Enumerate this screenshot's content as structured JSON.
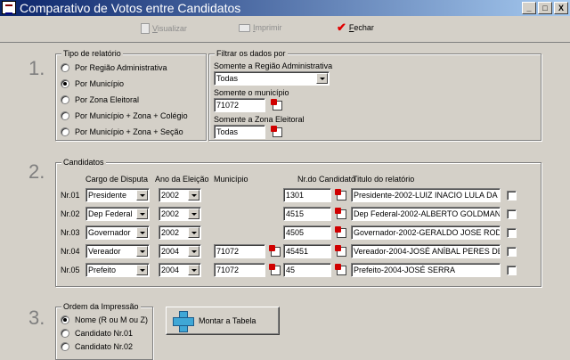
{
  "window": {
    "title": "Comparativo de Votos entre Candidatos",
    "buttons": [
      "_",
      "□",
      "X"
    ]
  },
  "toolbar": {
    "visualizar": {
      "first": "V",
      "rest": "isualizar"
    },
    "imprimir": {
      "first": "I",
      "rest": "mprimir"
    },
    "fechar": {
      "first": "F",
      "rest": "echar"
    }
  },
  "section1": {
    "number": "1.",
    "tipo_legend": "Tipo de relatório",
    "options": [
      "Por Região Administrativa",
      "Por Município",
      "Por Zona Eleitoral",
      "Por Município + Zona + Colégio",
      "Por Município + Zona + Seção"
    ],
    "selected_index": 1,
    "filtrar_legend": "Filtrar os dados por",
    "regiao_label": "Somente a Região Administrativa",
    "regiao_value": "Todas",
    "municipio_label": "Somente o município",
    "municipio_value": "71072",
    "zona_label": "Somente a Zona Eleitoral",
    "zona_value": "Todas"
  },
  "section2": {
    "number": "2.",
    "legend": "Candidatos",
    "headers": {
      "cargo": "Cargo de Disputa",
      "ano": "Ano da Eleição",
      "municipio": "Município",
      "nr": "Nr.do Candidato",
      "titulo": "Titulo do relatório"
    },
    "rows": [
      {
        "label": "Nr.01",
        "cargo": "Presidente",
        "ano": "2002",
        "municipio": "",
        "nr": "1301",
        "titulo": "Presidente-2002-LUIZ INACIO LULA DA"
      },
      {
        "label": "Nr.02",
        "cargo": "Dep Federal",
        "ano": "2002",
        "municipio": "",
        "nr": "4515",
        "titulo": "Dep Federal-2002-ALBERTO GOLDMAN"
      },
      {
        "label": "Nr.03",
        "cargo": "Governador",
        "ano": "2002",
        "municipio": "",
        "nr": "4505",
        "titulo": "Governador-2002-GERALDO JOSE ROD"
      },
      {
        "label": "Nr.04",
        "cargo": "Vereador",
        "ano": "2004",
        "municipio": "71072",
        "nr": "45451",
        "titulo": "Vereador-2004-JOSÉ ANÍBAL PERES DE"
      },
      {
        "label": "Nr.05",
        "cargo": "Prefeito",
        "ano": "2004",
        "municipio": "71072",
        "nr": "45",
        "titulo": "Prefeito-2004-JOSÉ SERRA"
      }
    ]
  },
  "section3": {
    "number": "3.",
    "legend": "Ordem da Impressão",
    "options": [
      "Nome (R ou M ou Z)",
      "Candidato Nr.01",
      "Candidato Nr.02"
    ],
    "selected_index": 0,
    "montar_label": "Montar a Tabela"
  },
  "icons": {
    "visualizar": "document-icon",
    "imprimir": "printer-icon",
    "fechar": "red-check-icon",
    "picker": "lookup-picker-icon",
    "montar": "blue-plus-icon"
  }
}
